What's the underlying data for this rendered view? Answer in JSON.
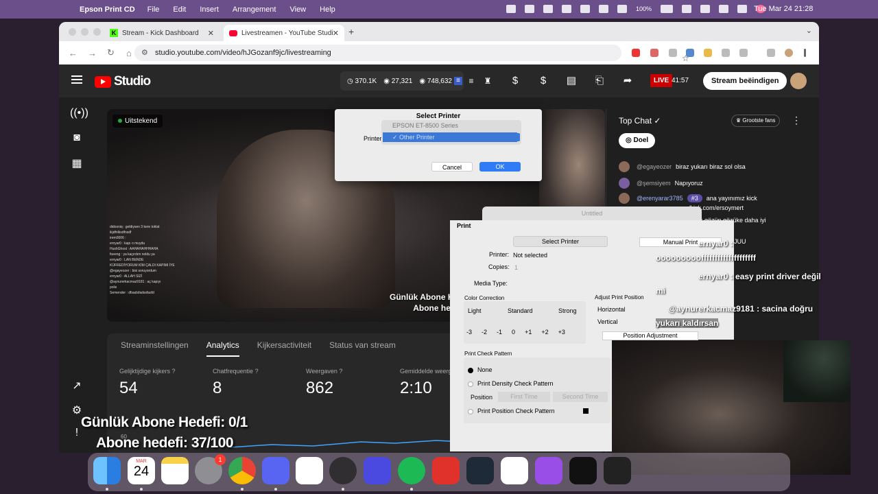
{
  "menubar": {
    "app": "Epson Print CD",
    "items": [
      "File",
      "Edit",
      "Insert",
      "Arrangement",
      "View",
      "Help"
    ],
    "battery": "100%",
    "clock": "Tue Mar 24  21:28"
  },
  "browser": {
    "tabs": [
      {
        "title": "Stream - Kick Dashboard"
      },
      {
        "title": "Livestreamen - YouTube Studi"
      }
    ],
    "url": "studio.youtube.com/video/hJGozanf9jc/livestreaming"
  },
  "studio": {
    "logo": "Studio",
    "stats": {
      "subs": "370.1K",
      "viewers": "27,321",
      "views": "748,632"
    },
    "live": "LIVE",
    "live_time": "41:57",
    "end_label": "Stream beëindigen"
  },
  "video": {
    "status": "Uitstekend",
    "overlay_line1": "Günlük Abone Hede",
    "overlay_line2": "Abone hedefi:",
    "overlay_chat": [
      "didosniq : geldiysen 3 kere toklat",
      "ikjdfnlksdfnsdf",
      "irem0006 :",
      "ernyar0 : kapı o muydu",
      "HushGhost : AAHAHAHHHAHA",
      "foeeng : ya kaçırdım noldu ya",
      "ernyar0 : LAN BENDE",
      "KÜFREDİYORUM KİM ÇALDI KAPIMI İYE",
      "@egayeozer : bisi soruyordum",
      "ernyar0 : ALLAH SİZİ",
      "@aynurerkacmaz9181 : aç kapıyı",
      "polis",
      "Semender : dfsadsfadssfasfd"
    ]
  },
  "panel": {
    "tabs": [
      "Streaminstellingen",
      "Analytics",
      "Kijkersactiviteit",
      "Status van stream"
    ],
    "metrics": [
      {
        "label": "Gelijktijdige kijkers",
        "value": "54"
      },
      {
        "label": "Chatfrequentie",
        "value": "8"
      },
      {
        "label": "Weergaven",
        "value": "862"
      },
      {
        "label": "Gemiddelde weerg",
        "value": "2:10"
      }
    ],
    "chart_label": "60"
  },
  "chat": {
    "title": "Top Chat",
    "fans": "Grootste fans",
    "goal": "Doel",
    "messages": [
      {
        "author": "@egayeozer",
        "text": "biraz yukarı biraz sol olsa"
      },
      {
        "author": "@şemsiyem",
        "text": "Napıyoruz"
      },
      {
        "author": "@erenyarar3785",
        "badge": "#3",
        "text": "ana yayınımız kick"
      }
    ],
    "partial": [
      "/kick.com/ersoymert",
      "k gözün gözüke daha iyi",
      "ence",
      "JUU"
    ]
  },
  "select_printer": {
    "title": "Select Printer",
    "label": "Printer:",
    "options": [
      "EPSON ET-8500 Series",
      "Other Printer"
    ],
    "selected": "Other Printer",
    "cancel": "Cancel",
    "ok": "OK"
  },
  "print_dialog": {
    "window_title": "Untitled",
    "title": "Print",
    "select_printer": "Select Printer",
    "manual_print": "Manual Print",
    "printer_label": "Printer:",
    "printer_value": "Not selected",
    "copies_label": "Copies:",
    "copies_value": "1",
    "media_label": "Media Type:",
    "color_correction": "Color Correction",
    "light": "Light",
    "standard": "Standard",
    "strong": "Strong",
    "scale": [
      "-3",
      "-2",
      "-1",
      "0",
      "+1",
      "+2",
      "+3"
    ],
    "scale_selected": "0",
    "adjust_pos": "Adjust Print Position",
    "horizontal": "Horizontal",
    "vertical": "Vertical",
    "pos_adjust": "Position Adjustment",
    "check_pattern": "Print Check Pattern",
    "opt_none": "None",
    "opt_density": "Print Density Check Pattern",
    "position": "Position",
    "first_time": "First Time",
    "second_time": "Second Time",
    "opt_position": "Print Position Check Pattern"
  },
  "stream_overlay": {
    "lines": [
      "ernyar0 :",
      "oooooooooffffffffffffffffffff",
      "ernyar0 : easy print driver değil",
      "mi",
      "@aynurerkacmaz9181 : sacina doğru",
      "yukarı kaldırsan"
    ],
    "goal1": "Günlük Abone Hedefi: 0/1",
    "goal2": "Abone hedefi: 37/100"
  },
  "dock": {
    "calendar_month": "MAR",
    "calendar_day": "24",
    "settings_badge": "1",
    "apps": [
      "finder-icon",
      "calendar-icon",
      "notes-icon",
      "settings-icon",
      "chrome-icon",
      "discord-icon",
      "notion-icon",
      "obs-icon",
      "launchpad-icon",
      "spotify-icon",
      "teams-icon",
      "kick-icon",
      "app-icon",
      "podcasts-icon",
      "audio-icon",
      "phone-icon"
    ]
  }
}
